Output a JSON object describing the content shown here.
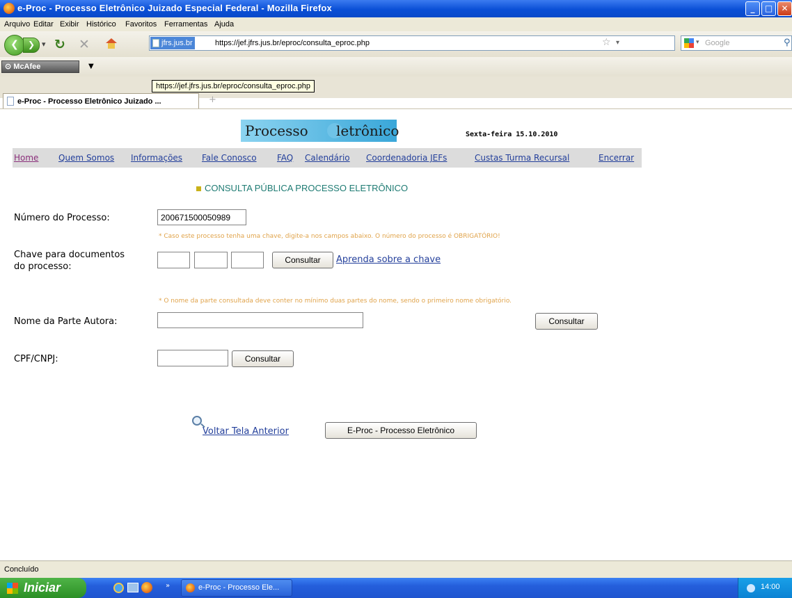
{
  "window": {
    "title": "e-Proc - Processo Eletrônico Juizado Especial Federal - Mozilla Firefox"
  },
  "menu": [
    "Arquivo",
    "Editar",
    "Exibir",
    "Histórico",
    "Favoritos",
    "Ferramentas",
    "Ajuda"
  ],
  "address_bar": {
    "site_badge": "jfrs.jus.br",
    "url": "https://jef.jfrs.jus.br/eproc/consulta_eproc.php",
    "tooltip": "https://jef.jfrs.jus.br/eproc/consulta_eproc.php"
  },
  "search_bar": {
    "placeholder": "Google"
  },
  "toolbar": {
    "mcafee_label": "McAfee"
  },
  "tab": {
    "title": "e-Proc - Processo Eletrônico Juizado ..."
  },
  "page": {
    "logo": {
      "part1": "Processo",
      "part2": "letrônico"
    },
    "date": "Sexta-feira 15.10.2010",
    "nav": [
      "Home",
      "Quem Somos",
      "Informações",
      "Fale Conosco",
      "FAQ",
      "Calendário",
      "Coordenadoria JEFs",
      "Custas Turma Recursal",
      "Encerrar"
    ],
    "section_title": "CONSULTA PÚBLICA PROCESSO ELETRÔNICO",
    "process_number": {
      "label": "Número do Processo:",
      "value": "200671500050989"
    },
    "hint_key": "* Caso este processo tenha uma chave, digite-a nos campos abaixo. O número do processo é OBRIGATÓRIO!",
    "key": {
      "label_line1": "Chave para documentos",
      "label_line2": "do processo:",
      "button": "Consultar",
      "help_link": "Aprenda sobre a chave"
    },
    "hint_name": "* O nome da parte consultada deve conter no mínimo duas partes do nome, sendo o primeiro nome obrigatório.",
    "party_name": {
      "label": "Nome da Parte Autora:",
      "value": "",
      "button": "Consultar"
    },
    "cpf": {
      "label": "CPF/CNPJ:",
      "value": "",
      "button": "Consultar"
    },
    "back_link": "Voltar Tela Anterior",
    "eproc_button": "E-Proc - Processo Eletrônico"
  },
  "status_bar": {
    "text": "Concluído"
  },
  "taskbar": {
    "start_label": "Iniciar",
    "task_label": "e-Proc - Processo Ele...",
    "clock": "14:00"
  }
}
